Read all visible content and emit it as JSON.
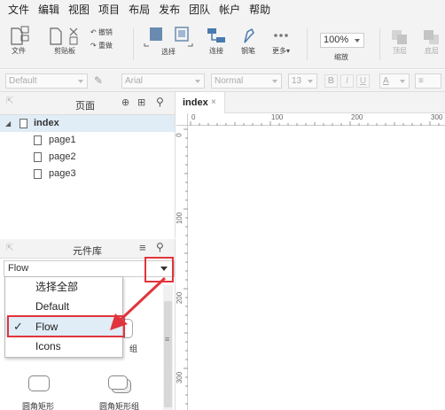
{
  "menu": [
    "文件",
    "编辑",
    "视图",
    "项目",
    "布局",
    "发布",
    "团队",
    "帐户",
    "帮助"
  ],
  "toolbar": {
    "file_label": "文件",
    "clipboard_label": "剪贴板",
    "undo_label": "撤销",
    "redo_label": "重做",
    "select_label": "选择",
    "connect_label": "连接",
    "pen_label": "钢笔",
    "more_label": "更多▾",
    "zoom_value": "100%",
    "zoom_label": "缩放",
    "top_label": "顶层",
    "bottom_label": "底层"
  },
  "format": {
    "style_value": "Default",
    "font_value": "Arial",
    "weight_value": "Normal",
    "size_value": "13",
    "bold": "B",
    "italic": "I",
    "underline": "U",
    "color_label": "A"
  },
  "pages_panel": {
    "title": "页面",
    "pages": [
      {
        "label": "index"
      },
      {
        "label": "page1"
      },
      {
        "label": "page2"
      },
      {
        "label": "page3"
      }
    ]
  },
  "library_panel": {
    "title": "元件库",
    "selected": "Flow",
    "options": [
      {
        "label": "选择全部"
      },
      {
        "label": "Default"
      },
      {
        "label": "Flow"
      },
      {
        "label": "Icons"
      }
    ],
    "check_mark": "✓",
    "shapes": [
      {
        "label": "圆角矩形"
      },
      {
        "label": "圆角矩形组"
      }
    ],
    "partial_label": "组"
  },
  "canvas": {
    "tab_label": "index",
    "tab_close": "×",
    "ruler_top": [
      "0",
      "100",
      "200",
      "300"
    ],
    "ruler_left": [
      "0",
      "100",
      "200",
      "300"
    ]
  },
  "colors": {
    "highlight": "#e0353d",
    "selection": "#e0ecf6"
  }
}
